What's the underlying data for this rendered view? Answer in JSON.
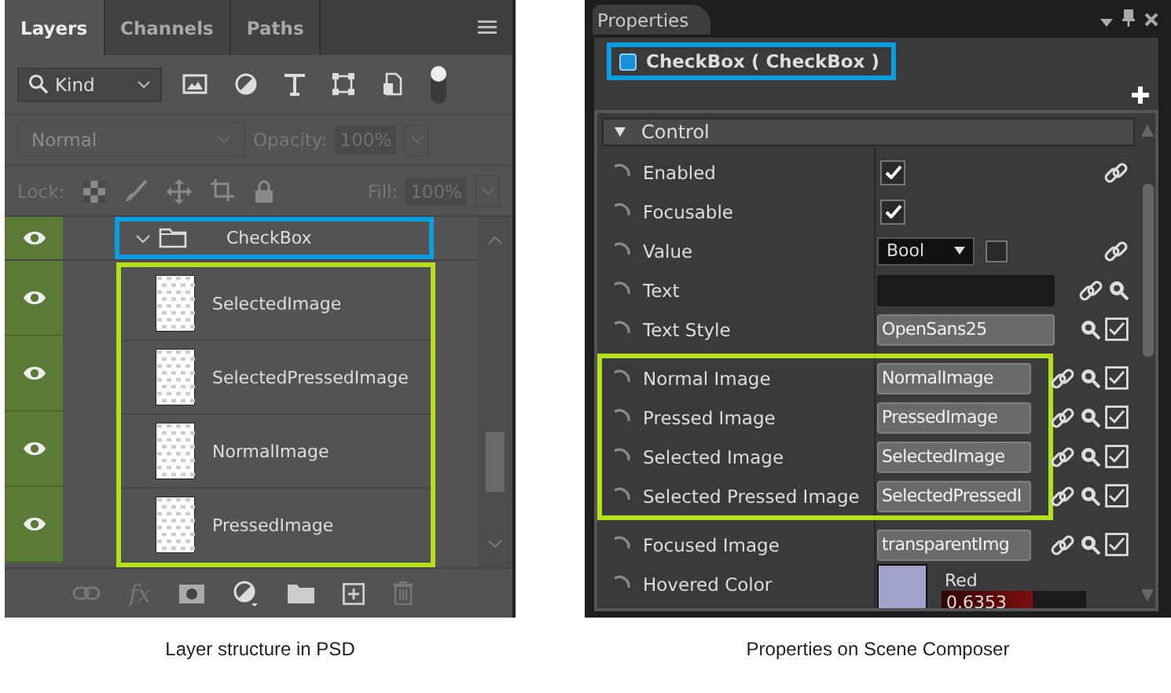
{
  "layers_panel": {
    "tabs": [
      {
        "label": "Layers",
        "selected": true
      },
      {
        "label": "Channels",
        "selected": false
      },
      {
        "label": "Paths",
        "selected": false
      }
    ],
    "filter": {
      "value": "Kind"
    },
    "blend_mode": "Normal",
    "opacity_label": "Opacity:",
    "opacity": "100%",
    "lock_label": "Lock:",
    "fill_label": "Fill:",
    "fill": "100%",
    "layers": [
      {
        "name": "CheckBox",
        "visible": true,
        "expanded": true,
        "highlighted": true,
        "children_highlighted": true,
        "children": [
          {
            "name": "SelectedImage",
            "visible": true
          },
          {
            "name": "SelectedPressedImage",
            "visible": true
          },
          {
            "name": "NormalImage",
            "visible": true
          },
          {
            "name": "PressedImage",
            "visible": true
          }
        ]
      }
    ],
    "effects_label": "fx",
    "caption": "Layer structure in PSD"
  },
  "properties_panel": {
    "tab": "Properties",
    "object": "CheckBox ( CheckBox )",
    "object_highlighted": true,
    "section": "Control",
    "section_expanded": true,
    "rows": [
      {
        "label": "Enabled",
        "kind": "checkbox",
        "checked": true,
        "link": true,
        "highlighted": false
      },
      {
        "label": "Focusable",
        "kind": "checkbox",
        "checked": true,
        "highlighted": false
      },
      {
        "label": "Value",
        "kind": "dropdown",
        "value": "Bool",
        "checked": false,
        "link": true,
        "highlighted": false
      },
      {
        "label": "Text",
        "kind": "text",
        "link": true,
        "browse": true,
        "highlighted": false
      },
      {
        "label": "Text Style",
        "kind": "asset",
        "value": "OpenSans25",
        "browse": true,
        "toggle": true,
        "highlighted": false
      },
      {
        "label": "Normal Image",
        "kind": "asset",
        "value": "NormalImage",
        "link": true,
        "browse": true,
        "toggle": true,
        "highlighted": true
      },
      {
        "label": "Pressed Image",
        "kind": "asset",
        "value": "PressedImage",
        "link": true,
        "browse": true,
        "toggle": true,
        "highlighted": true
      },
      {
        "label": "Selected Image",
        "kind": "asset",
        "value": "SelectedImage",
        "link": true,
        "browse": true,
        "toggle": true,
        "highlighted": true
      },
      {
        "label": "Selected Pressed Image",
        "kind": "asset",
        "value": "SelectedPressedI",
        "link": true,
        "browse": true,
        "toggle": true,
        "highlighted": true
      },
      {
        "label": "Focused Image",
        "kind": "asset",
        "value": "transparentImg",
        "link": true,
        "browse": true,
        "toggle": true,
        "highlighted": false
      },
      {
        "label": "Hovered Color",
        "kind": "color",
        "color": "#a3a3cc",
        "channel": "Red",
        "reading": "0.6353",
        "level": 0.6353,
        "highlighted": false
      }
    ],
    "caption": "Properties on Scene Composer"
  }
}
